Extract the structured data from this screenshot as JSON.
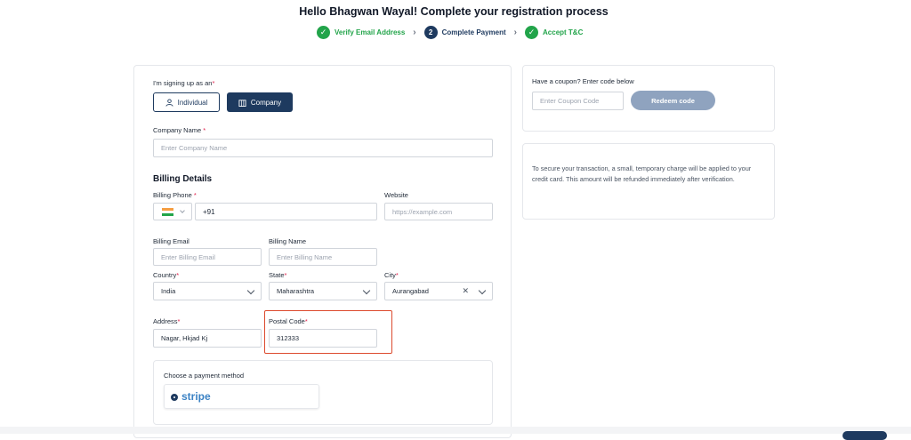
{
  "header": {
    "title": "Hello Bhagwan Wayal! Complete your registration process",
    "steps": [
      {
        "label": "Verify Email Address",
        "state": "done"
      },
      {
        "label": "Complete Payment",
        "state": "current",
        "number": "2"
      },
      {
        "label": "Accept T&C",
        "state": "done"
      }
    ]
  },
  "form": {
    "signing_up_label": "I'm signing up as an",
    "individual_label": "Individual",
    "company_label": "Company",
    "company_name_label": "Company Name",
    "company_name_placeholder": "Enter Company Name",
    "billing_details_title": "Billing Details",
    "billing_phone_label": "Billing Phone",
    "phone_code": "+91",
    "website_label": "Website",
    "website_placeholder": "https://example.com",
    "billing_email_label": "Billing Email",
    "billing_email_placeholder": "Enter Billing Email",
    "billing_name_label": "Billing Name",
    "billing_name_placeholder": "Enter Billing Name",
    "country_label": "Country",
    "country_value": "India",
    "state_label": "State",
    "state_value": "Maharashtra",
    "city_label": "City",
    "city_value": "Aurangabad",
    "address_label": "Address",
    "address_value": "Nagar, Hkjad Kj",
    "postal_code_label": "Postal Code",
    "postal_code_value": "312333",
    "payment_method_label": "Choose a payment method",
    "stripe_label": "stripe"
  },
  "coupon": {
    "label": "Have a coupon? Enter code below",
    "placeholder": "Enter Coupon Code",
    "redeem_label": "Redeem code"
  },
  "info": {
    "text": "To secure your transaction, a small, temporary charge will be applied to your credit card. This amount will be refunded immediately after verification."
  },
  "colors": {
    "primary": "#1e3a5f",
    "success": "#22a44a",
    "highlight": "#dc4a2e",
    "stripe": "#3b82c4"
  }
}
